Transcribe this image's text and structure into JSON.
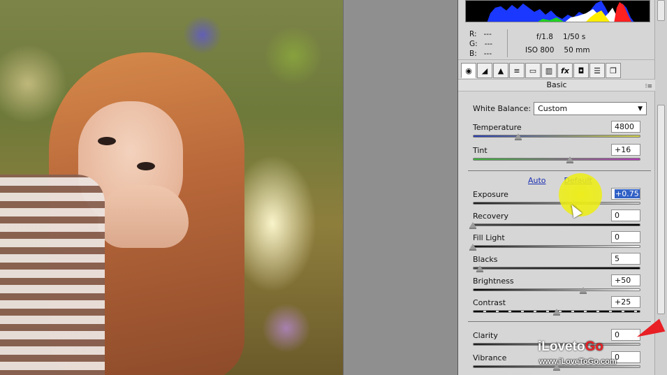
{
  "readout": {
    "r_label": "R:",
    "r_value": "---",
    "g_label": "G:",
    "g_value": "---",
    "b_label": "B:",
    "b_value": "---",
    "aperture": "f/1.8",
    "shutter": "1/50 s",
    "iso": "ISO 800",
    "focal": "50 mm"
  },
  "tabs": [
    {
      "icon": "basic-icon",
      "glyph": "◉"
    },
    {
      "icon": "tone-curve-icon",
      "glyph": "◢"
    },
    {
      "icon": "detail-icon",
      "glyph": "▲"
    },
    {
      "icon": "hsl-icon",
      "glyph": "≡"
    },
    {
      "icon": "split-toning-icon",
      "glyph": "▭"
    },
    {
      "icon": "lens-icon",
      "glyph": "▥"
    },
    {
      "icon": "effects-icon",
      "glyph": "fx"
    },
    {
      "icon": "camera-calibration-icon",
      "glyph": "◘"
    },
    {
      "icon": "presets-icon",
      "glyph": "☰"
    },
    {
      "icon": "snapshots-icon",
      "glyph": "❐"
    }
  ],
  "section": {
    "title": "Basic",
    "menu_glyph": "⁝≡"
  },
  "white_balance": {
    "label": "White Balance:",
    "value": "Custom"
  },
  "links": {
    "auto": "Auto",
    "default": "Default"
  },
  "sliders": {
    "temperature": {
      "label": "Temperature",
      "value": "4800",
      "level": 0.27
    },
    "tint": {
      "label": "Tint",
      "value": "+16",
      "level": 0.58
    },
    "exposure": {
      "label": "Exposure",
      "value": "+0.75",
      "level": 0.6
    },
    "recovery": {
      "label": "Recovery",
      "value": "0",
      "level": 0.0
    },
    "fill_light": {
      "label": "Fill Light",
      "value": "0",
      "level": 0.0
    },
    "blacks": {
      "label": "Blacks",
      "value": "5",
      "level": 0.04
    },
    "brightness": {
      "label": "Brightness",
      "value": "+50",
      "level": 0.66
    },
    "contrast": {
      "label": "Contrast",
      "value": "+25",
      "level": 0.5
    },
    "clarity": {
      "label": "Clarity",
      "value": "0",
      "level": 0.5
    },
    "vibrance": {
      "label": "Vibrance",
      "value": "0",
      "level": 0.5
    }
  },
  "watermark": {
    "brand_prefix": "iLoveto",
    "brand_suffix": "Go",
    "url": "www.iLoveToGo.com"
  }
}
